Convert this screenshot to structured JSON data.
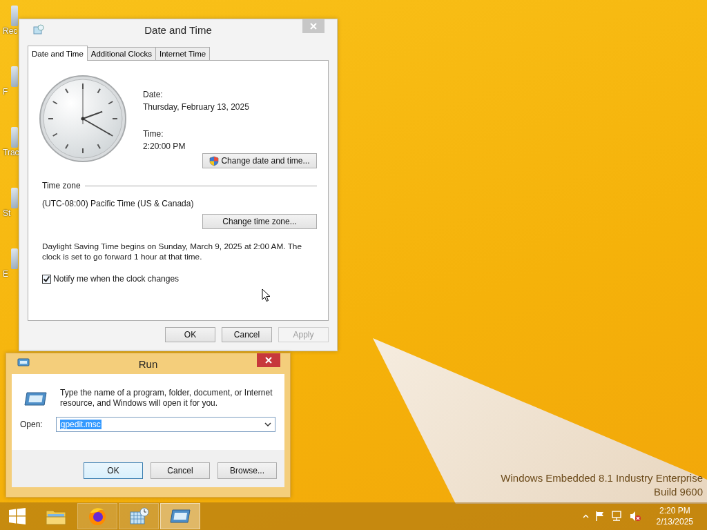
{
  "desktop": {
    "icons": [
      {
        "label": "Rec"
      },
      {
        "label": "F"
      },
      {
        "label": "Trac"
      },
      {
        "label": "St"
      },
      {
        "label": "E"
      }
    ],
    "edition": [
      "Windows Embedded 8.1 Industry Enterprise",
      "Build 9600"
    ]
  },
  "date_time_dialog": {
    "title": "Date and Time",
    "tabs": [
      {
        "label": "Date and Time",
        "selected": true
      },
      {
        "label": "Additional Clocks",
        "selected": false
      },
      {
        "label": "Internet Time",
        "selected": false
      }
    ],
    "date_label": "Date:",
    "date": "Thursday, February 13, 2025",
    "time_label": "Time:",
    "time": "2:20:00 PM",
    "change_date_button": "Change date and time...",
    "time_zone_heading": "Time zone",
    "time_zone": "(UTC-08:00) Pacific Time (US & Canada)",
    "change_zone_button": "Change time zone...",
    "dst_note": "Daylight Saving Time begins on Sunday, March 9, 2025 at 2:00 AM. The clock is set to go forward 1 hour at that time.",
    "notify": {
      "label": "Notify me when the clock changes",
      "checked": true
    },
    "buttons": [
      {
        "label": "OK",
        "disabled": false
      },
      {
        "label": "Cancel",
        "disabled": false
      },
      {
        "label": "Apply",
        "disabled": true
      }
    ]
  },
  "run_dialog": {
    "title": "Run",
    "description": "Type the name of a program, folder, document, or Internet resource, and Windows will open it for you.",
    "open_label": "Open:",
    "value": "gpedit.msc",
    "buttons": [
      {
        "label": "OK",
        "selected": true
      },
      {
        "label": "Cancel",
        "selected": false
      },
      {
        "label": "Browse...",
        "selected": false
      }
    ]
  },
  "taskbar": {
    "apps": [
      {
        "kind": "explorer",
        "running": false,
        "selected": false
      },
      {
        "kind": "firefox",
        "running": true,
        "selected": false
      },
      {
        "kind": "datetime",
        "running": true,
        "selected": false
      },
      {
        "kind": "run",
        "running": true,
        "selected": true
      }
    ],
    "clock": {
      "time": "2:20 PM",
      "date": "2/13/2025"
    }
  }
}
